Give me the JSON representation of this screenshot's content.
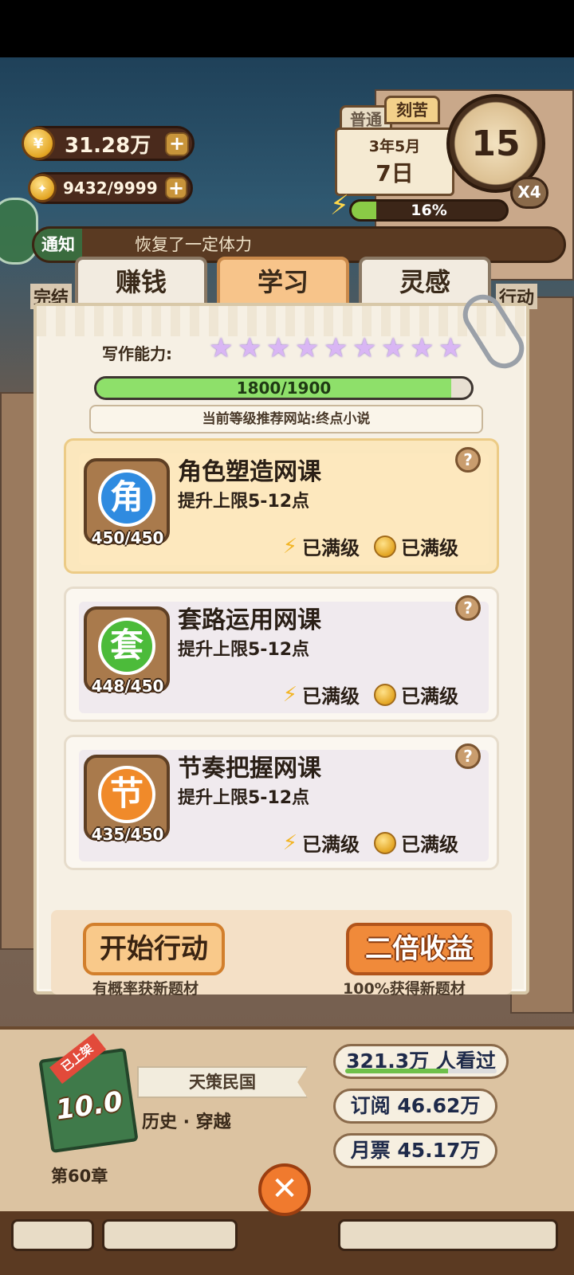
{
  "resources": {
    "coins": "31.28万",
    "ideas": "9432/9999",
    "plus": "+"
  },
  "calendar": {
    "mode_normal": "普通",
    "mode_hard": "刻苦",
    "year_month": "3年5月",
    "day": "7日",
    "timer": "15",
    "multiplier": "X4",
    "energy": "16%",
    "energy_value": 0.16
  },
  "notice": {
    "tag": "通知",
    "message": "恢复了一定体力",
    "side_left": "完结",
    "side_right": "行动"
  },
  "tabs": [
    {
      "label": "赚钱"
    },
    {
      "label": "学习"
    },
    {
      "label": "灵感"
    }
  ],
  "writing": {
    "label": "写作能力:",
    "star_glyph": "★",
    "stars": 9,
    "progress_text": "1800/1900",
    "progress_value": 0.9474,
    "recommend": "当前等级推荐网站:终点小说"
  },
  "courses": [
    {
      "glyph": "角",
      "title": "角色塑造网课",
      "desc": "提升上限5-12点",
      "count": "450/450",
      "color": "#2f8be0",
      "energy_status": "已满级",
      "coin_status": "已满级"
    },
    {
      "glyph": "套",
      "title": "套路运用网课",
      "desc": "提升上限5-12点",
      "count": "448/450",
      "color": "#4cbb3a",
      "energy_status": "已满级",
      "coin_status": "已满级"
    },
    {
      "glyph": "节",
      "title": "节奏把握网课",
      "desc": "提升上限5-12点",
      "count": "435/450",
      "color": "#f08a2a",
      "energy_status": "已满级",
      "coin_status": "已满级"
    }
  ],
  "actions": {
    "start": "开始行动",
    "start_caption": "有概率获新题材",
    "double": "二倍收益",
    "double_caption": "100%获得新题材",
    "help": "?"
  },
  "book": {
    "tag": "已上架",
    "score": "10.0",
    "title": "天策民国",
    "genre": "历史 · 穿越",
    "chapter": "第60章",
    "views": "321.3万 人看过",
    "subscriptions": "订阅 46.62万",
    "monthly_tickets": "月票 45.17万"
  },
  "close_label": "✕"
}
